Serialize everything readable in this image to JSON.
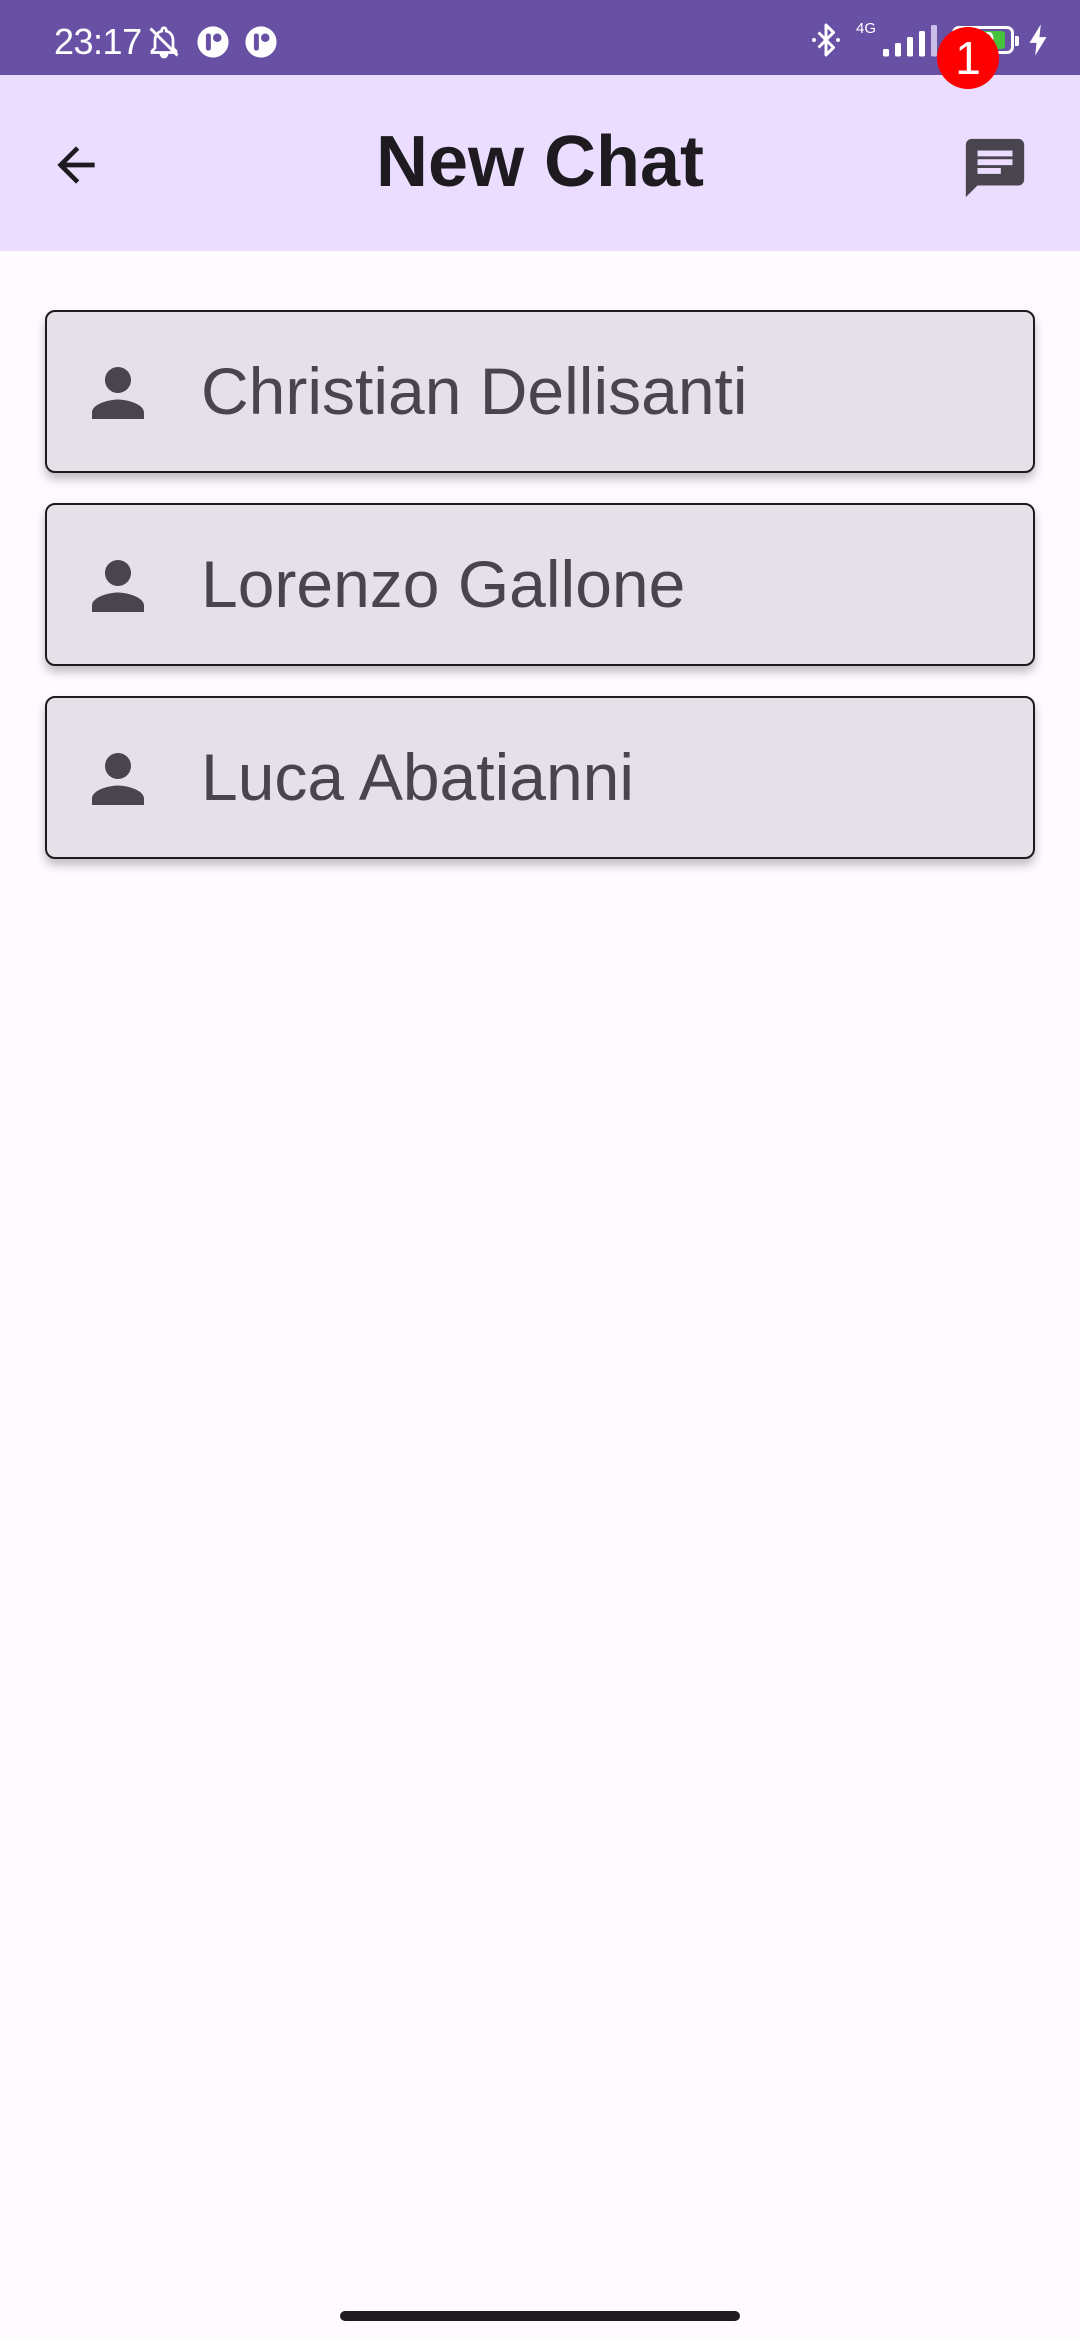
{
  "status_bar": {
    "time": "23:17",
    "network": "4G",
    "battery_level": "89",
    "background_color": "#6851a5",
    "icons": [
      "bell-off-icon",
      "app-icon",
      "app-icon",
      "bluetooth-icon",
      "signal-icon",
      "battery-icon",
      "charging-icon"
    ]
  },
  "app_bar": {
    "title": "New Chat",
    "back_icon": "arrow-back-icon",
    "chat_icon": "chat-icon",
    "notification_count": "1",
    "background_color": "#eaddff"
  },
  "contacts": [
    {
      "name": "Christian Dellisanti",
      "icon": "person-icon"
    },
    {
      "name": "Lorenzo Gallone",
      "icon": "person-icon"
    },
    {
      "name": "Luca Abatianni",
      "icon": "person-icon"
    }
  ],
  "colors": {
    "card_background": "#e6e0e9",
    "text_secondary": "#49454f",
    "badge": "#ff0000",
    "page_background": "#fefbff"
  }
}
